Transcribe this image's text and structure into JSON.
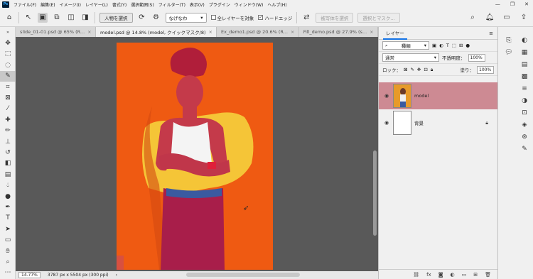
{
  "menubar": {
    "logo": "Ps",
    "items": [
      "ファイル(F)",
      "編集(E)",
      "イメージ(I)",
      "レイヤー(L)",
      "書式(Y)",
      "選択範囲(S)",
      "フィルター(T)",
      "表示(V)",
      "プラグイン",
      "ウィンドウ(W)",
      "ヘルプ(H)"
    ]
  },
  "optbar": {
    "subject_btn": "人物を選択",
    "sample_select": "なげなわ",
    "all_layers": "全レイヤーを対象",
    "hard_edge": "ハードエッジ",
    "select_mask": "被写体を選択",
    "select_mask2": "選択とマスク..."
  },
  "tabs": [
    {
      "label": "slide_01-01.psd @ 65% (R...",
      "active": false
    },
    {
      "label": "model.psd @ 14.8% (model, クイックマスク/8)",
      "active": true
    },
    {
      "label": "Ex_demo1.psd @ 20.6% (R...",
      "active": false
    },
    {
      "label": "Fill_demo.psd @ 27.9% (s...",
      "active": false
    }
  ],
  "status": {
    "zoom": "14.77%",
    "doc_size": "3787 px x 5504 px (300 ppi)"
  },
  "layers_panel": {
    "title": "レイヤー",
    "filter_label": "種類",
    "blend_mode": "通常",
    "opacity_label": "不透明度：",
    "opacity_value": "100%",
    "lock_label": "ロック：",
    "fill_label": "塗り：",
    "fill_value": "100%",
    "layers": [
      {
        "name": "model",
        "selected": true
      },
      {
        "name": "背景",
        "selected": false
      }
    ],
    "footer_fx": "fx"
  },
  "colors": {
    "accent": "#1473e6",
    "quickmask": "#cd8a93",
    "doc_bg": "#ef5a12",
    "mask_shape": "#f5c537"
  }
}
